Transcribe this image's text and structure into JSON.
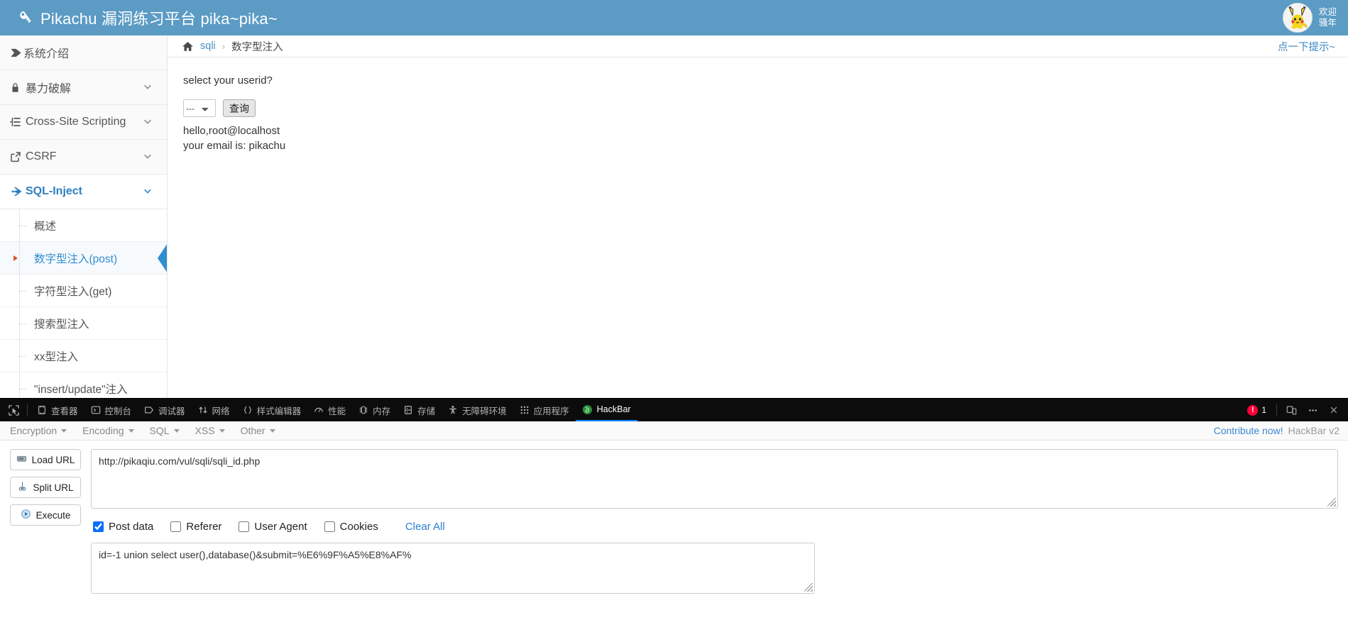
{
  "header": {
    "title": "Pikachu 漏洞练习平台 pika~pika~",
    "brand_icon": "key-icon",
    "welcome_line1": "欢迎",
    "welcome_line2": "骚年",
    "bg_color": "#5b9bc4"
  },
  "sidebar": {
    "items": [
      {
        "label": "系统介绍",
        "icon": "tag-icon",
        "caret": false,
        "active": false
      },
      {
        "label": "暴力破解",
        "icon": "lock-icon",
        "caret": true,
        "active": false
      },
      {
        "label": "Cross-Site Scripting",
        "icon": "list-icon",
        "caret": true,
        "active": false
      },
      {
        "label": "CSRF",
        "icon": "external-link-icon",
        "caret": true,
        "active": false
      },
      {
        "label": "SQL-Inject",
        "icon": "plane-icon",
        "caret": true,
        "active": true
      }
    ],
    "sub_items": [
      {
        "label": "概述",
        "active": false
      },
      {
        "label": "数字型注入(post)",
        "active": true
      },
      {
        "label": "字符型注入(get)",
        "active": false
      },
      {
        "label": "搜索型注入",
        "active": false
      },
      {
        "label": "xx型注入",
        "active": false
      },
      {
        "label": "\"insert/update\"注入",
        "active": false
      }
    ]
  },
  "breadcrumb": {
    "home_icon": "home-icon",
    "link": "sqli",
    "separator": "›",
    "current": "数字型注入",
    "hint_link": "点一下提示~"
  },
  "main": {
    "prompt": "select your userid?",
    "select_value": "---",
    "query_button": "查询",
    "result_line1": "hello,root@localhost",
    "result_line2": "your email is: pikachu"
  },
  "devtools": {
    "picker_icon": "element-picker-icon",
    "tabs": [
      {
        "label": "查看器",
        "icon": "inspector-icon",
        "active": false
      },
      {
        "label": "控制台",
        "icon": "console-icon",
        "active": false
      },
      {
        "label": "调试器",
        "icon": "debugger-icon",
        "active": false
      },
      {
        "label": "网络",
        "icon": "network-icon",
        "active": false
      },
      {
        "label": "样式编辑器",
        "icon": "style-editor-icon",
        "active": false
      },
      {
        "label": "性能",
        "icon": "performance-icon",
        "active": false
      },
      {
        "label": "内存",
        "icon": "memory-icon",
        "active": false
      },
      {
        "label": "存储",
        "icon": "storage-icon",
        "active": false
      },
      {
        "label": "无障碍环境",
        "icon": "accessibility-icon",
        "active": false
      },
      {
        "label": "应用程序",
        "icon": "application-icon",
        "active": false
      },
      {
        "label": "HackBar",
        "icon": "hackbar-icon",
        "active": true
      }
    ],
    "error_count": "1",
    "responsive_icon": "responsive-design-icon",
    "meatball_icon": "more-options-icon",
    "close_icon": "close-icon"
  },
  "hackbar": {
    "menus": [
      "Encryption",
      "Encoding",
      "SQL",
      "XSS",
      "Other"
    ],
    "contribute": "Contribute now!",
    "version": "HackBar v2",
    "buttons": [
      {
        "label": "Load URL",
        "icon": "disk-icon"
      },
      {
        "label": "Split URL",
        "icon": "scissors-icon"
      },
      {
        "label": "Execute",
        "icon": "play-icon"
      }
    ],
    "url_value": "http://pikaqiu.com/vul/sqli/sqli_id.php",
    "checkboxes": [
      {
        "label": "Post data",
        "checked": true
      },
      {
        "label": "Referer",
        "checked": false
      },
      {
        "label": "User Agent",
        "checked": false
      },
      {
        "label": "Cookies",
        "checked": false
      }
    ],
    "clear_all": "Clear All",
    "post_data": "id=-1 union select user(),database()&submit=%E6%9F%A5%E8%AF%"
  }
}
